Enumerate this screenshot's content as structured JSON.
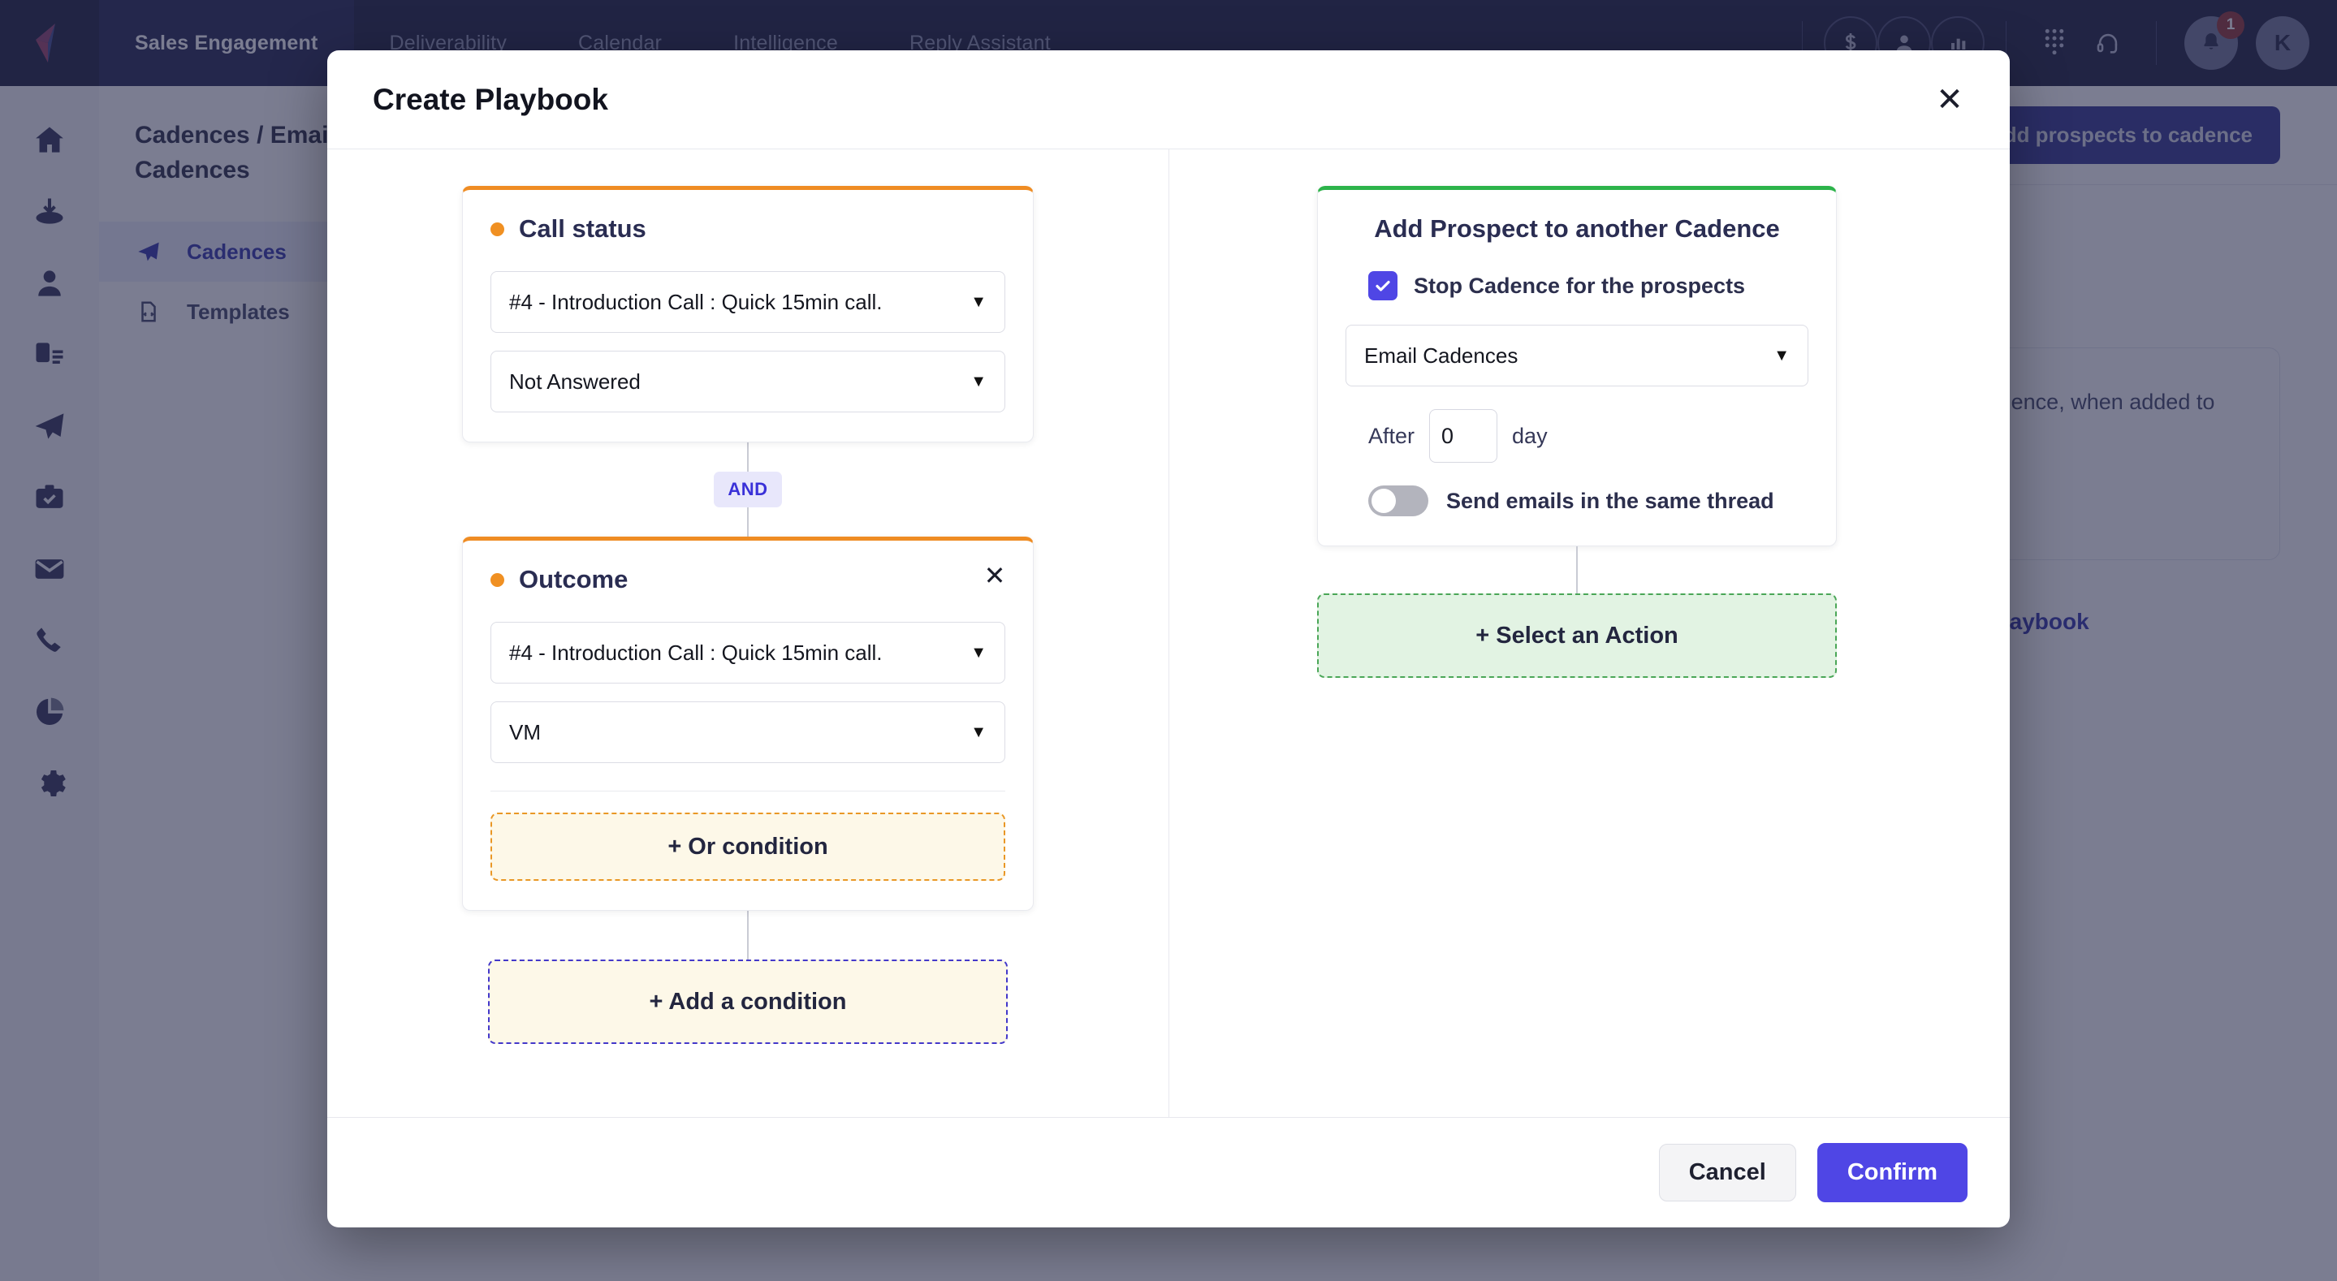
{
  "topnav": {
    "logo_name": "outplay-logo",
    "tabs": [
      {
        "label": "Sales Engagement",
        "active": true
      },
      {
        "label": "Deliverability",
        "active": false
      },
      {
        "label": "Calendar",
        "active": false
      },
      {
        "label": "Intelligence",
        "active": false
      },
      {
        "label": "Reply Assistant",
        "active": false
      }
    ],
    "icons": [
      "dollar-icon",
      "person-icon",
      "bar-chart-icon",
      "dialpad-icon",
      "headset-icon"
    ],
    "notification_count": "1",
    "avatar_initial": "K"
  },
  "sidebar": {
    "icons": [
      "home-icon",
      "inbox-icon",
      "person-icon",
      "document-icon",
      "paper-plane-icon",
      "tasks-icon",
      "mail-icon",
      "phone-icon",
      "pie-chart-icon",
      "gear-icon"
    ]
  },
  "subnav": {
    "breadcrumb": "Cadences / Email Cadences",
    "items": [
      {
        "label": "Cadences",
        "icon": "paper-plane-icon",
        "active": true
      },
      {
        "label": "Templates",
        "icon": "template-icon",
        "active": false
      }
    ]
  },
  "content": {
    "add_prospects_label": "Add prospects to cadence",
    "empty_card_text": "Add prospects to Cadence, when added to list",
    "empty_card_link": "Create a playbook",
    "create_playbook_link": "+ Create a playbook"
  },
  "modal": {
    "title": "Create Playbook",
    "close_label": "✕",
    "footer": {
      "cancel_label": "Cancel",
      "confirm_label": "Confirm"
    },
    "conditions": [
      {
        "title": "Call status",
        "dot_color": "#f09022",
        "accent": "#ef8c23",
        "selects": [
          {
            "value": "#4 - Introduction Call : Quick 15min call."
          },
          {
            "value": "Not Answered"
          }
        ],
        "has_close": false,
        "or_label": null
      },
      {
        "title": "Outcome",
        "dot_color": "#f09022",
        "accent": "#ef8c23",
        "selects": [
          {
            "value": "#4 - Introduction Call : Quick 15min call."
          },
          {
            "value": "VM"
          }
        ],
        "has_close": true,
        "close_label": "✕",
        "or_label": "+ Or condition"
      }
    ],
    "operator_badge": "AND",
    "add_condition_label": "+ Add a condition",
    "action": {
      "title": "Add Prospect to another Cadence",
      "accent": "#2cb34a",
      "checkbox": {
        "label": "Stop Cadence for the prospects",
        "checked": true
      },
      "cadence_select": {
        "value": "Email Cadences"
      },
      "after_label": "After",
      "after_value": "0",
      "day_label": "day",
      "toggle": {
        "label": "Send emails in the same thread",
        "on": false
      }
    },
    "select_action_label": "+ Select an Action"
  },
  "colors": {
    "accent_indigo": "#4f46e5",
    "accent_orange": "#ef8c23",
    "accent_green": "#2cb34a",
    "nav_dark": "#141636"
  }
}
